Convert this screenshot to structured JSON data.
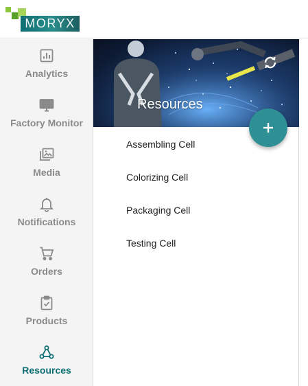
{
  "brand": {
    "logo_text": "MORYX"
  },
  "sidebar": {
    "items": [
      {
        "label": "Analytics",
        "icon": "analytics-icon",
        "active": false
      },
      {
        "label": "Factory Monitor",
        "icon": "monitor-icon",
        "active": false
      },
      {
        "label": "Media",
        "icon": "media-icon",
        "active": false
      },
      {
        "label": "Notifications",
        "icon": "bell-icon",
        "active": false
      },
      {
        "label": "Orders",
        "icon": "cart-icon",
        "active": false
      },
      {
        "label": "Products",
        "icon": "clipboard-check-icon",
        "active": false
      },
      {
        "label": "Resources",
        "icon": "resources-graph-icon",
        "active": true
      }
    ]
  },
  "panel": {
    "title": "Resources",
    "refresh_icon": "refresh-icon",
    "add_icon": "plus-icon",
    "resources": [
      "Assembling Cell",
      "Colorizing Cell",
      "Packaging Cell",
      "Testing Cell"
    ]
  },
  "colors": {
    "accent": "#0e6e73",
    "fab": "#2e8f94",
    "inactive_text": "#8a8a8a",
    "sidebar_bg": "#f4f4f4"
  }
}
